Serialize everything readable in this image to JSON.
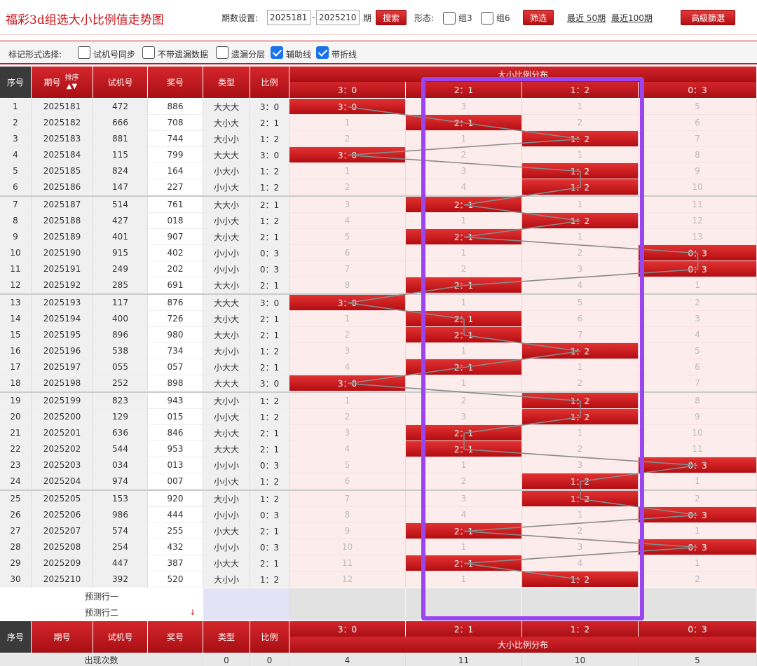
{
  "header": {
    "title": "福彩3d组选大小比例值走势图",
    "period_label": "期数设置:",
    "period_start": "2025181",
    "period_dash": "-",
    "period_end": "2025210",
    "period_unit": "期",
    "search_label": "搜索",
    "form_label": "形态:",
    "group3_label": "组3",
    "group6_label": "组6",
    "filter_label": "筛选",
    "recent50_label": "最近 50期",
    "recent100_label": "最近100期",
    "advanced_label": "高級篩選"
  },
  "marks": {
    "label": "标记形式选择:",
    "options": [
      {
        "label": "试机号同步",
        "checked": false
      },
      {
        "label": "不带遗漏数据",
        "checked": false
      },
      {
        "label": "遗漏分层",
        "checked": false
      },
      {
        "label": "辅助线",
        "checked": true
      },
      {
        "label": "带折线",
        "checked": true
      }
    ]
  },
  "columns": {
    "seq": "序号",
    "period": "期号",
    "sort": "排序",
    "test": "试机号",
    "prize": "奖号",
    "type": "类型",
    "ratio": "比例",
    "dist_title": "大小比例分布",
    "dist": [
      "3：0",
      "2：1",
      "1：2",
      "0：3"
    ]
  },
  "rows": [
    {
      "seq": "1",
      "period": "2025181",
      "test": "472",
      "prize": "886",
      "type": "大大大",
      "ratio": "3：0",
      "hit": 0,
      "miss": [
        "3：0",
        "3",
        "1",
        "5"
      ]
    },
    {
      "seq": "2",
      "period": "2025182",
      "test": "666",
      "prize": "708",
      "type": "大小大",
      "ratio": "2：1",
      "hit": 1,
      "miss": [
        "1",
        "2：1",
        "2",
        "6"
      ]
    },
    {
      "seq": "3",
      "period": "2025183",
      "test": "881",
      "prize": "744",
      "type": "大小小",
      "ratio": "1：2",
      "hit": 2,
      "miss": [
        "2",
        "1",
        "1：2",
        "7"
      ]
    },
    {
      "seq": "4",
      "period": "2025184",
      "test": "115",
      "prize": "799",
      "type": "大大大",
      "ratio": "3：0",
      "hit": 0,
      "miss": [
        "3：0",
        "2",
        "1",
        "8"
      ]
    },
    {
      "seq": "5",
      "period": "2025185",
      "test": "824",
      "prize": "164",
      "type": "小大小",
      "ratio": "1：2",
      "hit": 2,
      "miss": [
        "1",
        "3",
        "1：2",
        "9"
      ]
    },
    {
      "seq": "6",
      "period": "2025186",
      "test": "147",
      "prize": "227",
      "type": "小小大",
      "ratio": "1：2",
      "hit": 2,
      "miss": [
        "2",
        "4",
        "1：2",
        "10"
      ]
    },
    {
      "seq": "7",
      "period": "2025187",
      "test": "514",
      "prize": "761",
      "type": "大大小",
      "ratio": "2：1",
      "hit": 1,
      "miss": [
        "3",
        "2：1",
        "1",
        "11"
      ]
    },
    {
      "seq": "8",
      "period": "2025188",
      "test": "427",
      "prize": "018",
      "type": "小小大",
      "ratio": "1：2",
      "hit": 2,
      "miss": [
        "4",
        "1",
        "1：2",
        "12"
      ]
    },
    {
      "seq": "9",
      "period": "2025189",
      "test": "401",
      "prize": "907",
      "type": "大小大",
      "ratio": "2：1",
      "hit": 1,
      "miss": [
        "5",
        "2：1",
        "1",
        "13"
      ]
    },
    {
      "seq": "10",
      "period": "2025190",
      "test": "915",
      "prize": "402",
      "type": "小小小",
      "ratio": "0：3",
      "hit": 3,
      "miss": [
        "6",
        "1",
        "2",
        "0：3"
      ]
    },
    {
      "seq": "11",
      "period": "2025191",
      "test": "249",
      "prize": "202",
      "type": "小小小",
      "ratio": "0：3",
      "hit": 3,
      "miss": [
        "7",
        "2",
        "3",
        "0：3"
      ]
    },
    {
      "seq": "12",
      "period": "2025192",
      "test": "285",
      "prize": "691",
      "type": "大大小",
      "ratio": "2：1",
      "hit": 1,
      "miss": [
        "8",
        "2：1",
        "4",
        "1"
      ]
    },
    {
      "seq": "13",
      "period": "2025193",
      "test": "117",
      "prize": "876",
      "type": "大大大",
      "ratio": "3：0",
      "hit": 0,
      "miss": [
        "3：0",
        "1",
        "5",
        "2"
      ]
    },
    {
      "seq": "14",
      "period": "2025194",
      "test": "400",
      "prize": "726",
      "type": "大小大",
      "ratio": "2：1",
      "hit": 1,
      "miss": [
        "1",
        "2：1",
        "6",
        "3"
      ]
    },
    {
      "seq": "15",
      "period": "2025195",
      "test": "896",
      "prize": "980",
      "type": "大大小",
      "ratio": "2：1",
      "hit": 1,
      "miss": [
        "2",
        "2：1",
        "7",
        "4"
      ]
    },
    {
      "seq": "16",
      "period": "2025196",
      "test": "538",
      "prize": "734",
      "type": "大小小",
      "ratio": "1：2",
      "hit": 2,
      "miss": [
        "3",
        "1",
        "1：2",
        "5"
      ]
    },
    {
      "seq": "17",
      "period": "2025197",
      "test": "055",
      "prize": "057",
      "type": "小大大",
      "ratio": "2：1",
      "hit": 1,
      "miss": [
        "4",
        "2：1",
        "1",
        "6"
      ]
    },
    {
      "seq": "18",
      "period": "2025198",
      "test": "252",
      "prize": "898",
      "type": "大大大",
      "ratio": "3：0",
      "hit": 0,
      "miss": [
        "3：0",
        "1",
        "2",
        "7"
      ]
    },
    {
      "seq": "19",
      "period": "2025199",
      "test": "823",
      "prize": "943",
      "type": "大小小",
      "ratio": "1：2",
      "hit": 2,
      "miss": [
        "1",
        "2",
        "1：2",
        "8"
      ]
    },
    {
      "seq": "20",
      "period": "2025200",
      "test": "129",
      "prize": "015",
      "type": "小小大",
      "ratio": "1：2",
      "hit": 2,
      "miss": [
        "2",
        "3",
        "1：2",
        "9"
      ]
    },
    {
      "seq": "21",
      "period": "2025201",
      "test": "636",
      "prize": "846",
      "type": "大小大",
      "ratio": "2：1",
      "hit": 1,
      "miss": [
        "3",
        "2：1",
        "1",
        "10"
      ]
    },
    {
      "seq": "22",
      "period": "2025202",
      "test": "544",
      "prize": "953",
      "type": "大大大",
      "ratio": "2：1",
      "hit": 1,
      "miss": [
        "4",
        "2：1",
        "2",
        "11"
      ]
    },
    {
      "seq": "23",
      "period": "2025203",
      "test": "034",
      "prize": "013",
      "type": "小小小",
      "ratio": "0：3",
      "hit": 3,
      "miss": [
        "5",
        "1",
        "3",
        "0：3"
      ]
    },
    {
      "seq": "24",
      "period": "2025204",
      "test": "974",
      "prize": "007",
      "type": "小小大",
      "ratio": "1：2",
      "hit": 2,
      "miss": [
        "6",
        "2",
        "1：2",
        "1"
      ]
    },
    {
      "seq": "25",
      "period": "2025205",
      "test": "153",
      "prize": "920",
      "type": "大小小",
      "ratio": "1：2",
      "hit": 2,
      "miss": [
        "7",
        "3",
        "1：2",
        "2"
      ]
    },
    {
      "seq": "26",
      "period": "2025206",
      "test": "986",
      "prize": "444",
      "type": "小小小",
      "ratio": "0：3",
      "hit": 3,
      "miss": [
        "8",
        "4",
        "1",
        "0：3"
      ]
    },
    {
      "seq": "27",
      "period": "2025207",
      "test": "574",
      "prize": "255",
      "type": "小大大",
      "ratio": "2：1",
      "hit": 1,
      "miss": [
        "9",
        "2：1",
        "2",
        "1"
      ]
    },
    {
      "seq": "28",
      "period": "2025208",
      "test": "254",
      "prize": "432",
      "type": "小小小",
      "ratio": "0：3",
      "hit": 3,
      "miss": [
        "10",
        "1",
        "3",
        "0：3"
      ]
    },
    {
      "seq": "29",
      "period": "2025209",
      "test": "447",
      "prize": "387",
      "type": "小大大",
      "ratio": "2：1",
      "hit": 1,
      "miss": [
        "11",
        "2：1",
        "4",
        "1"
      ]
    },
    {
      "seq": "30",
      "period": "2025210",
      "test": "392",
      "prize": "520",
      "type": "大小小",
      "ratio": "1：2",
      "hit": 2,
      "miss": [
        "12",
        "1",
        "1：2",
        "2"
      ]
    }
  ],
  "prediction": {
    "row1": "预测行一",
    "row2": "预测行二"
  },
  "footer": {
    "count_label": "出现次数",
    "type_count": "0",
    "ratio_count": "0",
    "dist_counts": [
      "4",
      "11",
      "10",
      "5"
    ]
  },
  "colors": {
    "brand_red": "#c8161d",
    "highlight": "#9b45f0",
    "miss_bg": "#fdecec"
  }
}
